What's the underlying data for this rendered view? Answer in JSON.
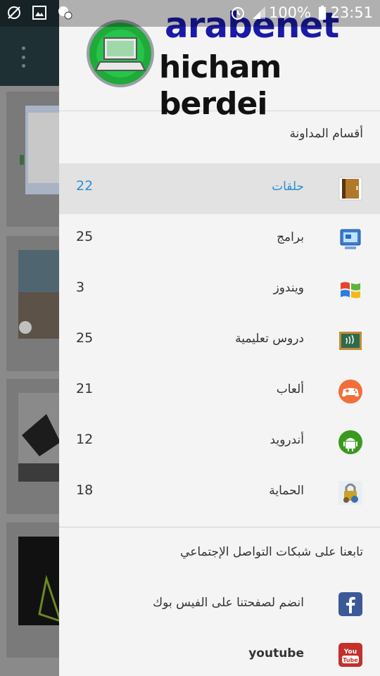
{
  "status_bar": {
    "battery_text": "100%",
    "time": "23:51",
    "icons": [
      "no-sync-icon",
      "gallery-icon",
      "settings-notify-icon",
      "alarm-icon",
      "signal-icon",
      "battery-icon"
    ]
  },
  "header": {
    "logo_line1": "arabenet",
    "logo_line2": "hicham berdei",
    "accent_green": "#1faa3a",
    "accent_blue": "#1a1aa8"
  },
  "categories": {
    "title": "أقسام المداونة",
    "items": [
      {
        "label": "حلقات",
        "count": "22",
        "icon": "book-icon",
        "active": true
      },
      {
        "label": "برامج",
        "count": "25",
        "icon": "computer-icon"
      },
      {
        "label": "ويندوز",
        "count": "3",
        "icon": "windows-icon"
      },
      {
        "label": "دروس تعليمية",
        "count": "25",
        "icon": "blackboard-icon"
      },
      {
        "label": "ألعاب",
        "count": "21",
        "icon": "gamepad-icon"
      },
      {
        "label": "أندرويد",
        "count": "12",
        "icon": "android-icon"
      },
      {
        "label": "الحماية",
        "count": "18",
        "icon": "lock-icon"
      }
    ],
    "active_color": "#2a8fd6"
  },
  "social": {
    "title": "تابعنا على شبكات التواصل الإجتماعي",
    "items": [
      {
        "label": "انضم لصفحتنا على الفيس بوك",
        "icon": "facebook-icon"
      },
      {
        "label": "youtube",
        "icon": "youtube-icon"
      }
    ]
  }
}
